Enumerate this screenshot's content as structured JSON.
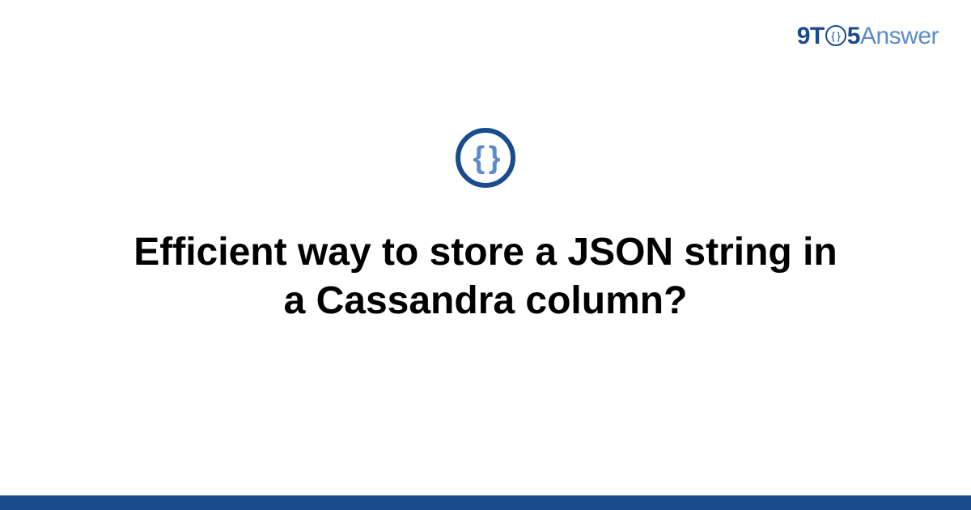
{
  "logo": {
    "part1": "9T",
    "clock": "{ }",
    "part2": "5",
    "part3": "Answer"
  },
  "category_icon": "{ }",
  "title": "Efficient way to store a JSON string in a Cassandra column?"
}
